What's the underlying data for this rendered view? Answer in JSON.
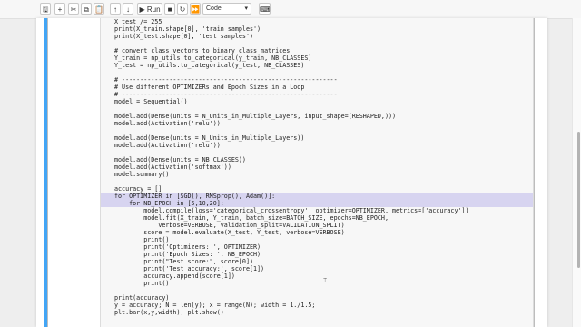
{
  "toolbar": {
    "save": "🖫",
    "add": "+",
    "cut": "✂",
    "copy": "⧉",
    "paste": "📋",
    "up": "↑",
    "down": "↓",
    "run": "▶ Run",
    "stop": "■",
    "restart": "↻",
    "restart_run": "⏩",
    "cell_type": "Code",
    "keyboard": "⌨"
  },
  "code_lines": [
    "X_test /= 255",
    "print(X_train.shape[0], 'train samples')",
    "print(X_test.shape[0], 'test samples')",
    "",
    "# convert class vectors to binary class matrices",
    "Y_train = np_utils.to_categorical(y_train, NB_CLASSES)",
    "Y_test = np_utils.to_categorical(y_test, NB_CLASSES)",
    "",
    "# -----------------------------------------------------------",
    "# Use different OPTIMIZERs and Epoch Sizes in a Loop",
    "# -----------------------------------------------------------",
    "model = Sequential()",
    "",
    "model.add(Dense(units = N_Units_in_Multiple_Layers, input_shape=(RESHAPED,)))",
    "model.add(Activation('relu'))",
    "",
    "model.add(Dense(units = N_Units_in_Multiple_Layers))",
    "model.add(Activation('relu'))",
    "",
    "model.add(Dense(units = NB_CLASSES))",
    "model.add(Activation('softmax'))",
    "model.summary()",
    "",
    "accuracy = []",
    "for OPTIMIZER in [SGD(), RMSprop(), Adam()]:",
    "    for NB_EPOCH in [5,10,20]:",
    "        model.compile(loss='categorical_crossentropy', optimizer=OPTIMIZER, metrics=['accuracy'])",
    "        model.fit(X_train, Y_train, batch_size=BATCH_SIZE, epochs=NB_EPOCH,",
    "            verbose=VERBOSE, validation_split=VALIDATION_SPLIT)",
    "        score = model.evaluate(X_test, Y_test, verbose=VERBOSE)",
    "        print()",
    "        print('Optimizers: ', OPTIMIZER)",
    "        print('Epoch Sizes: ', NB_EPOCH)",
    "        print(\"Test score:\", score[0])",
    "        print('Test accuracy:', score[1])",
    "        accuracy.append(score[1])",
    "        print()",
    "",
    "print(accuracy)",
    "y = accuracy; N = len(y); x = range(N); width = 1./1.5;",
    "plt.bar(x,y,width); plt.show()"
  ],
  "highlighted_lines": [
    24,
    25
  ],
  "colors": {
    "cell_accent": "#42a5f5",
    "selection": "#d7d4f0"
  }
}
